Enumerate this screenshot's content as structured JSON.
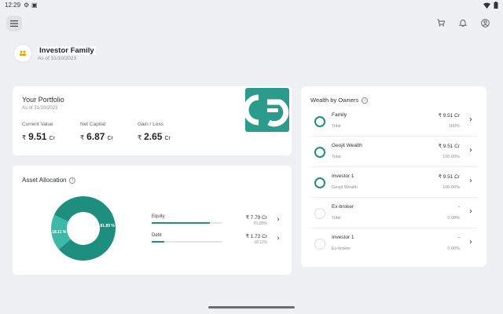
{
  "status_bar": {
    "time": "12:29",
    "icons": [
      "settings-icon",
      "notification-icon",
      "wifi-icon",
      "battery-icon"
    ]
  },
  "header": {
    "menu_icon": "menu-icon",
    "actions": [
      "cart-icon",
      "bell-icon",
      "account-icon"
    ],
    "family_name": "Investor Family",
    "as_of": "As of 31/10/2023"
  },
  "portfolio": {
    "title": "Your Portfolio",
    "as_of": "As of 31/10/2023",
    "metrics": [
      {
        "label": "Current Value",
        "currency": "₹",
        "value": "9.51",
        "unit": "Cr"
      },
      {
        "label": "Net Capital",
        "currency": "₹",
        "value": "6.87",
        "unit": "Cr"
      },
      {
        "label": "Gain / Loss",
        "currency": "₹",
        "value": "2.65",
        "unit": "Cr"
      }
    ],
    "logo": "geojit-logo"
  },
  "allocation": {
    "title": "Asset Allocation",
    "donut": [
      {
        "name": "Equity",
        "percent": 81.89,
        "label": "81.89 %",
        "color": "#1e8e7e"
      },
      {
        "name": "Debt",
        "percent": 18.11,
        "label": "18.11 %",
        "color": "#3fb8a5"
      }
    ],
    "rows": [
      {
        "label": "Equity",
        "amount": "₹ 7.79 Cr",
        "pct": "81.89%",
        "fill": 0.8189
      },
      {
        "label": "Debt",
        "amount": "₹ 1.72 Cr",
        "pct": "18.11%",
        "fill": 0.1811
      }
    ]
  },
  "wealth": {
    "title": "Wealth by Owners",
    "owners": [
      {
        "name": "Family",
        "sub": "Total",
        "value": "₹ 9.51 Cr",
        "pct": "100%",
        "filled": true
      },
      {
        "name": "Geojit Wealth",
        "sub": "Total",
        "value": "₹ 9.51 Cr",
        "pct": "100.00%",
        "filled": true
      },
      {
        "name": "Investor 1",
        "sub": "Geojit Wealth",
        "value": "₹ 9.51 Cr",
        "pct": "100.00%",
        "filled": true
      },
      {
        "name": "Ex-broker",
        "sub": "Total",
        "value": "-",
        "pct": "0.00%",
        "filled": false
      },
      {
        "name": "Investor 1",
        "sub": "Ex-broker",
        "value": "-",
        "pct": "0.00%",
        "filled": false
      }
    ]
  },
  "colors": {
    "accent": "#1e8e7e",
    "accent_light": "#3fb8a5",
    "logo_bg": "#2b9c8c",
    "background": "#eef0f2"
  }
}
